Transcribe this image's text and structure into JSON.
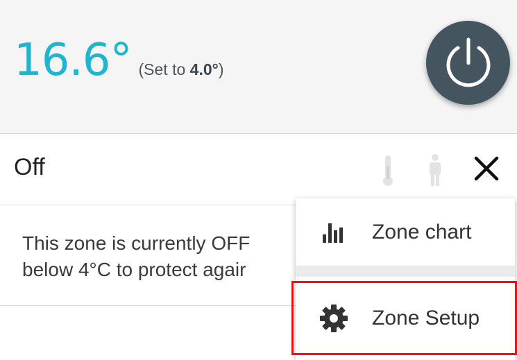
{
  "zone": {
    "temperature": "16.6°",
    "set_prefix": "(Set to ",
    "set_value": "4.0°",
    "set_suffix": ")",
    "mode": "Off",
    "description_line1": "This zone is currently OFF",
    "description_line2": "below 4°C to protect agair"
  },
  "menu": {
    "items": [
      {
        "label": "Zone chart",
        "icon": "bar-chart-icon"
      },
      {
        "label": "Zone Setup",
        "icon": "gear-icon"
      }
    ]
  },
  "colors": {
    "temperature": "#1fb5d1",
    "power_button": "#455560",
    "highlight": "#e0161b"
  }
}
